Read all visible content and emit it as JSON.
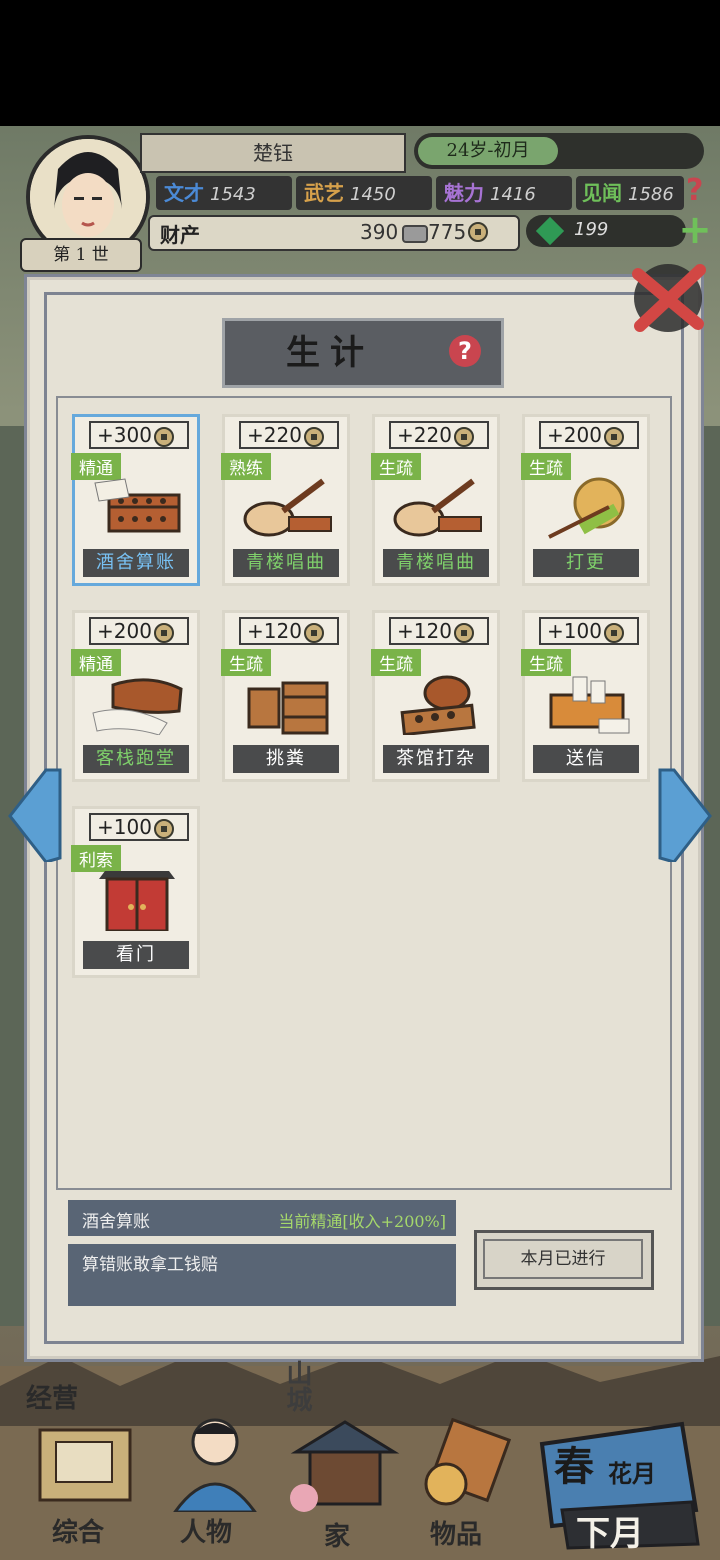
{
  "player": {
    "name": "楚钰",
    "age_label": "24岁-初月",
    "life_label": "第 1 世",
    "stats": [
      {
        "label": "文才",
        "value": "1543",
        "color": "#4b8ad6"
      },
      {
        "label": "武艺",
        "value": "1450",
        "color": "#d6a14b"
      },
      {
        "label": "魅力",
        "value": "1416",
        "color": "#a773d4"
      },
      {
        "label": "见闻",
        "value": "1586",
        "color": "#6fc05a"
      }
    ],
    "help": "?",
    "wealth_label": "财产",
    "silver": "390",
    "copper": "775",
    "jade": "199",
    "add": "+"
  },
  "panel": {
    "title": "生计",
    "help": "?",
    "jobs": [
      {
        "income": "+300",
        "rank": "精通",
        "name": "酒舍算账",
        "label_color": "blue",
        "selected": true
      },
      {
        "income": "+220",
        "rank": "熟练",
        "name": "青楼唱曲",
        "label_color": "green"
      },
      {
        "income": "+220",
        "rank": "生疏",
        "name": "青楼唱曲",
        "label_color": "green"
      },
      {
        "income": "+200",
        "rank": "生疏",
        "name": "打更",
        "label_color": "green"
      },
      {
        "income": "+200",
        "rank": "精通",
        "name": "客栈跑堂",
        "label_color": "green"
      },
      {
        "income": "+120",
        "rank": "生疏",
        "name": "挑粪",
        "label_color": "white"
      },
      {
        "income": "+120",
        "rank": "生疏",
        "name": "茶馆打杂",
        "label_color": "white"
      },
      {
        "income": "+100",
        "rank": "生疏",
        "name": "送信",
        "label_color": "white"
      },
      {
        "income": "+100",
        "rank": "利索",
        "name": "看门",
        "label_color": "white"
      }
    ],
    "detail_name": "酒舍算账",
    "detail_status": "当前精通[收入+200%]",
    "detail_desc": "算错账敢拿工钱赔",
    "done_button": "本月已进行"
  },
  "nav": {
    "section_label": "经营",
    "city_label": "山城",
    "items": [
      "综合",
      "人物",
      "家",
      "物品"
    ],
    "season": "春",
    "month": "花月",
    "next": "下月"
  }
}
